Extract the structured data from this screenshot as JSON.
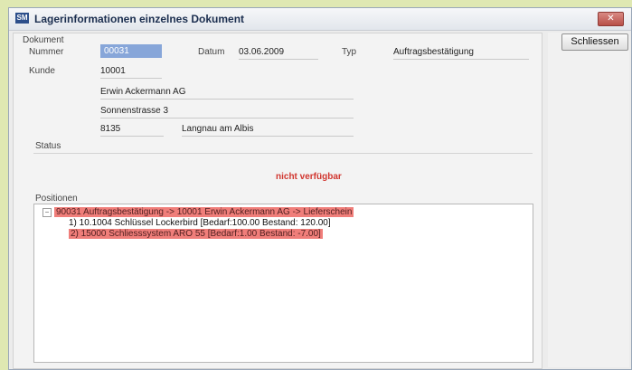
{
  "window": {
    "icon_text": "SM",
    "title": "Lagerinformationen einzelnes Dokument",
    "close_label": "✕"
  },
  "document": {
    "section_label": "Dokument",
    "number_label": "Nummer",
    "number_value": "00031",
    "date_label": "Datum",
    "date_value": "03.06.2009",
    "type_label": "Typ",
    "type_value": "Auftragsbestätigung"
  },
  "customer": {
    "label": "Kunde",
    "id": "10001",
    "name": "Erwin Ackermann AG",
    "street": "Sonnenstrasse 3",
    "zip": "8135",
    "city": "Langnau am Albis"
  },
  "status": {
    "label": "Status",
    "value": "nicht verfügbar"
  },
  "positions": {
    "label": "Positionen",
    "toggle": "−",
    "root": "90031 Auftragsbestätigung -> 10001 Erwin Ackermann AG -> Lieferschein",
    "items": [
      "1) 10.1004 Schlüssel Lockerbird [Bedarf:100.00 Bestand: 120.00]",
      "2) 15000 Schliesssystem ARO 55 [Bedarf:1.00 Bestand: -7.00]"
    ]
  },
  "actions": {
    "close_button": "Schliessen"
  },
  "colors": {
    "background": "#dfe8b2",
    "selection": "#87a6d9",
    "warning_red": "#d1362f",
    "tree_highlight": "#f07e7a"
  }
}
